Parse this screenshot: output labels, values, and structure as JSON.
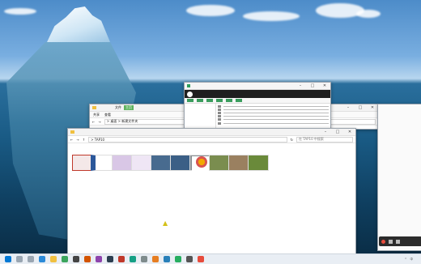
{
  "explorer_main": {
    "title": "",
    "address": "> TAP10",
    "search_placeholder": "在 TAP10 中搜索",
    "status_right": "",
    "files": [
      {
        "label": "",
        "color": "#c0392b"
      },
      {
        "label": "",
        "color": "#2b579a"
      },
      {
        "label": "",
        "color": "#d9c7e6"
      },
      {
        "label": "",
        "color": "#b48fd1"
      },
      {
        "label": "",
        "color": "#486b8f"
      },
      {
        "label": "",
        "color": "#3b5f86"
      },
      {
        "label": "",
        "color": "#8a8f94"
      },
      {
        "label": "",
        "color": "#f2a900"
      },
      {
        "label": "",
        "color": "#7a8d4f"
      },
      {
        "label": "",
        "color": "#9a8060"
      },
      {
        "label": "",
        "color": "#6a8a3a"
      }
    ]
  },
  "explorer_back": {
    "nav_text": "> 桌面 > 新建文件夹",
    "ribbon": [
      "文件",
      "主页",
      "共享",
      "查看"
    ]
  },
  "dialog": {
    "title": "",
    "heading": "",
    "toolbar": [
      "",
      "",
      "",
      "",
      "",
      ""
    ]
  },
  "taskbar": {
    "start_icon": "windows-icon",
    "apps": [
      "search-icon",
      "task-view-icon",
      "edge-icon",
      "folder-icon",
      "app-icon",
      "app-icon",
      "app-icon",
      "app-icon",
      "app-icon",
      "app-icon",
      "app-icon",
      "app-icon",
      "app-icon",
      "app-icon",
      "app-icon",
      "app-icon",
      "app-icon",
      "app-icon"
    ],
    "time": "",
    "lang": "中"
  }
}
